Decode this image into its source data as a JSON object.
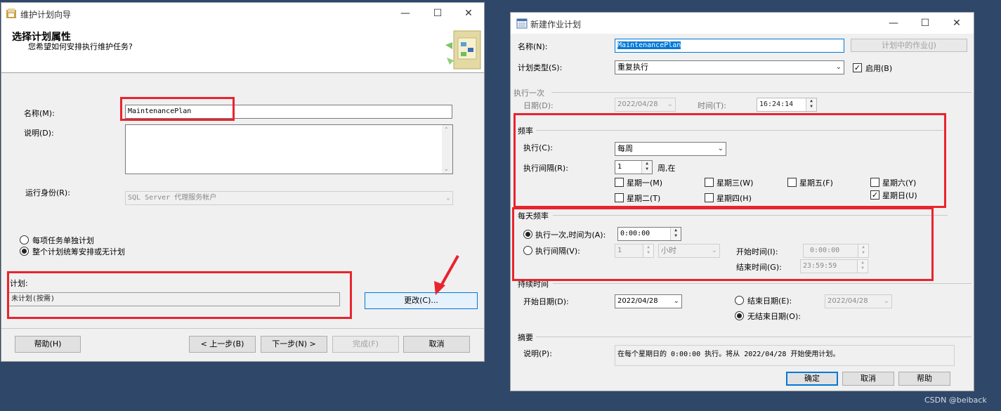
{
  "wizard": {
    "title": "维护计划向导",
    "header_title": "选择计划属性",
    "header_subtitle": "您希望如何安排执行维护任务?",
    "name_label": "名称(M):",
    "name_value": "MaintenancePlan",
    "desc_label": "说明(D):",
    "runas_label": "运行身份(R):",
    "runas_value": "SQL Server 代理服务帐户",
    "radio_separate": "每项任务单独计划",
    "radio_whole": "整个计划统筹安排或无计划",
    "schedule_label": "计划:",
    "schedule_value": "未计划(按需)",
    "change_button": "更改(C)...",
    "help_button": "帮助(H)",
    "back_button": "< 上一步(B)",
    "next_button": "下一步(N) >",
    "finish_button": "完成(F)",
    "cancel_button": "取消"
  },
  "job_schedule": {
    "title": "新建作业计划",
    "name_label": "名称(N):",
    "name_value": "MaintenancePlan",
    "jobs_in_schedule_button": "计划中的作业(J)",
    "schedule_type_label": "计划类型(S):",
    "schedule_type_value": "重复执行",
    "enabled_label": "启用(B)",
    "enabled_checked": true,
    "one_time": {
      "group": "执行一次",
      "date_label": "日期(D):",
      "date_value": "2022/04/28",
      "time_label": "时间(T):",
      "time_value": "16:24:14"
    },
    "frequency": {
      "group": "频率",
      "occurs_label": "执行(C):",
      "occurs_value": "每周",
      "recurs_label": "执行间隔(R):",
      "recurs_value": "1",
      "recurs_unit": "周,在",
      "days": [
        {
          "label": "星期一(M)",
          "checked": false
        },
        {
          "label": "星期三(W)",
          "checked": false
        },
        {
          "label": "星期五(F)",
          "checked": false
        },
        {
          "label": "星期六(Y)",
          "checked": false
        },
        {
          "label": "星期二(T)",
          "checked": false
        },
        {
          "label": "星期四(H)",
          "checked": false
        },
        {
          "label": "星期日(U)",
          "checked": true
        }
      ]
    },
    "daily": {
      "group": "每天频率",
      "once_label": "执行一次,时间为(A):",
      "once_value": "0:00:00",
      "every_label": "执行间隔(V):",
      "every_value": "1",
      "every_unit": "小时",
      "start_label": "开始时间(I):",
      "start_value": "0:00:00",
      "end_label": "结束时间(G):",
      "end_value": "23:59:59"
    },
    "duration": {
      "group": "持续时间",
      "start_date_label": "开始日期(D):",
      "start_date_value": "2022/04/28",
      "end_date_label": "结束日期(E):",
      "end_date_value": "2022/04/28",
      "no_end_label": "无结束日期(O):"
    },
    "summary": {
      "group": "摘要",
      "desc_label": "说明(P):",
      "desc_value": "在每个星期日的 0:00:00 执行。将从 2022/04/28 开始使用计划。"
    },
    "ok_button": "确定",
    "cancel_button": "取消",
    "help_button": "帮助"
  },
  "watermark": "CSDN @beiback",
  "colors": {
    "highlight": "#e8242e",
    "selection": "#0078d7",
    "desktop": "#2f4769"
  }
}
